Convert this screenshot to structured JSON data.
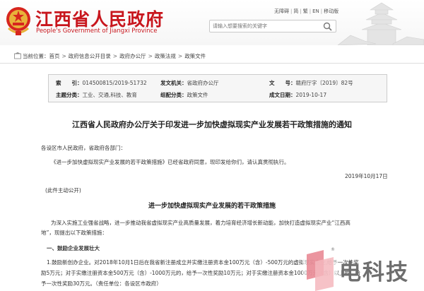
{
  "header": {
    "title": "江西省人民政府",
    "subtitle": "People's Government of Jiangxi Province",
    "toplinks": [
      "无障碍",
      "简",
      "繁",
      "EN",
      "移动版"
    ],
    "search_placeholder": "请输入想要搜索的关键字",
    "emblem_icon": "national-emblem-icon",
    "accent_color": "#c8161d"
  },
  "breadcrumb": {
    "label": "当前位置：",
    "items": [
      "首页",
      "政府信息公开目录",
      "政府办公厅",
      "政策法规",
      "政策文件"
    ]
  },
  "meta": {
    "index_label": "索　　引：",
    "index_value": "014500815/2019-51732",
    "issuer_label": "发文机关：",
    "issuer_value": "省政府办公厅",
    "docno_label": "文　　号：",
    "docno_value": "赣府厅字〔2019〕82号",
    "topic_label": "主题分类：",
    "topic_value": "工业、交通,科技、教育",
    "form_label": "组配分类：",
    "form_value": "政策文件",
    "date_label": "成文日期：",
    "date_value": "2019-10-17"
  },
  "doc": {
    "title": "江西省人民政府办公厅关于印发进一步加快虚拟现实产业发展若干政策措施的通知",
    "salutation": "各设区市人民政府，省政府各部门：",
    "body1": "《进一步加快虚拟现实产业发展的若干政策措施》已经省政府同意，现印发给你们，请认真贯彻执行。",
    "date": "2019年10月17日",
    "public_note": "(此件主动公开)",
    "subtitle": "进一步加快虚拟现实产业发展的若干政策措施",
    "intro1": "为深入实施工业强省战略，进一步推动我省虚拟现实产业高质量发展，着力培育经济增长新动能，加快打造虚拟现实产业“江西高",
    "intro2": "地”，现提出以下政策措施：",
    "section1": "一、鼓励企业发展壮大",
    "item1a": "1.鼓励新创办企业。对2018年10月1日后在我省新注册成立并实缴注册资本金100万元（含）-500万元的虚拟现实企业,给予一次性奖",
    "item1b": "励5万元；对于实缴注册资本金500万元（含）-1000万元的，给予一次性奖励10万元；对于实缴注册资本金1000万元（含）以上的，给",
    "item1c": "予一次性奖励30万元。（责任单位：各设区市政府）"
  },
  "watermark": {
    "text": "电科技",
    "registered": "®"
  }
}
